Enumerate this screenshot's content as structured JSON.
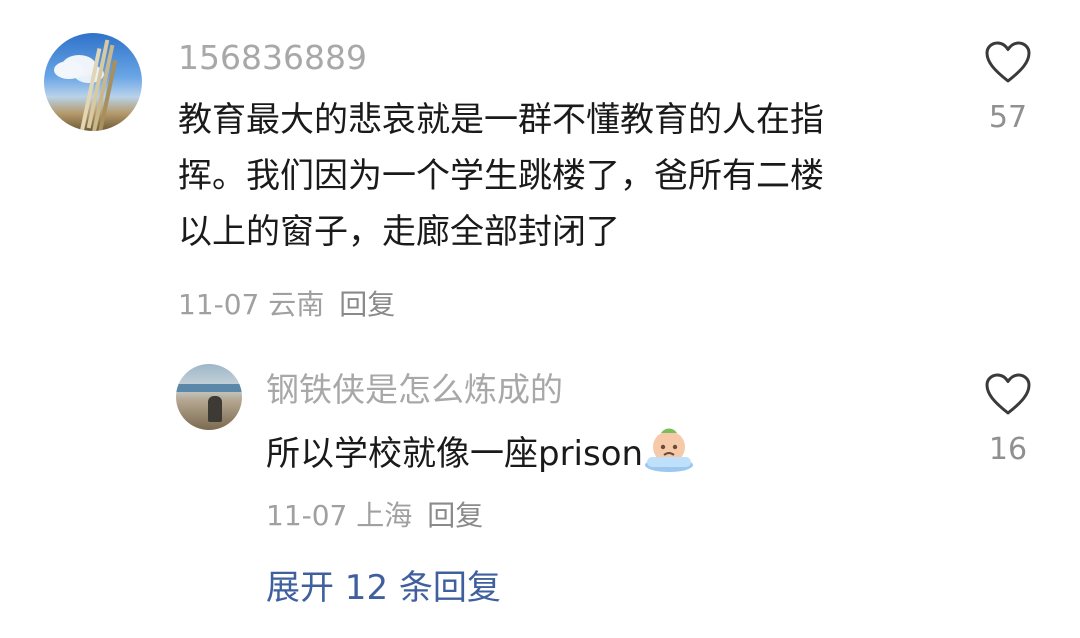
{
  "comment": {
    "username": "156836889",
    "text_lines": [
      "教育最大的悲哀就是一群不懂教育的人在指",
      "挥。我们因为一个学生跳楼了，爸所有二楼",
      "以上的窗子，走廊全部封闭了"
    ],
    "date": "11-07",
    "location": "云南",
    "reply_label": "回复",
    "like_count": "57",
    "like_icon": "heart-outline-icon",
    "avatar": "landscape-photo-avatar"
  },
  "reply": {
    "username": "钢铁侠是怎么炼成的",
    "text": "所以学校就像一座prison",
    "emoji": "crying-face-emoji",
    "date": "11-07",
    "location": "上海",
    "reply_label": "回复",
    "like_count": "16",
    "like_icon": "heart-outline-icon",
    "avatar": "beach-photo-avatar"
  },
  "expand_replies": "展开 12 条回复",
  "colors": {
    "username": "#a8a8a8",
    "content": "#1a1a1a",
    "meta": "#a0a0a0",
    "link": "#3f5f9e"
  }
}
